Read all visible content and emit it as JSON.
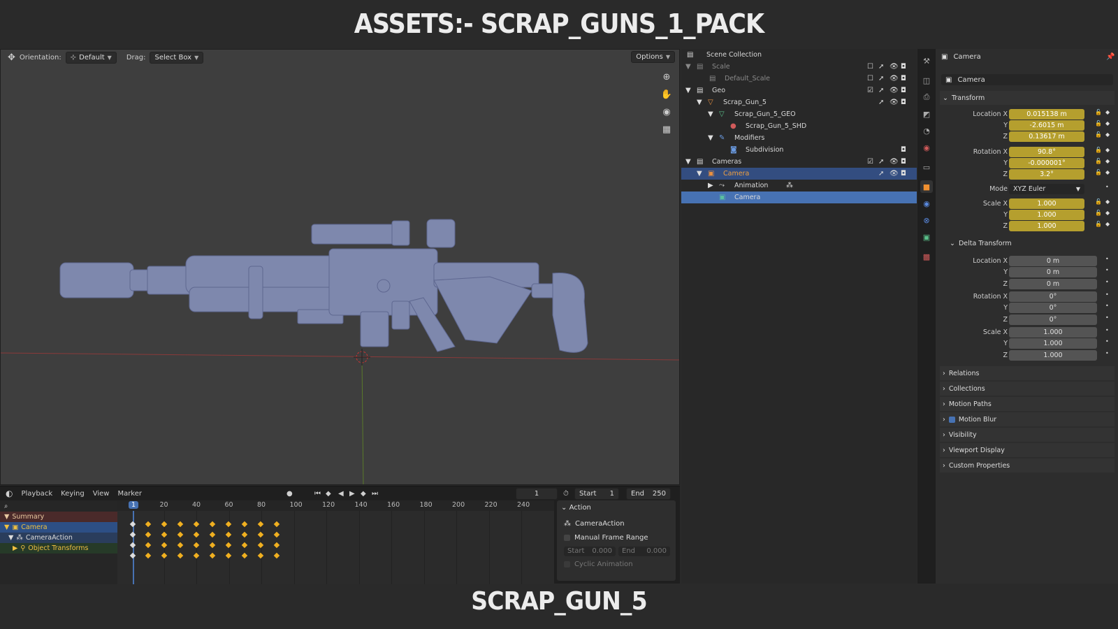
{
  "banner": {
    "top": "ASSETS:- SCRAP_GUNS_1_PACK",
    "bottom": "SCRAP_GUN_5"
  },
  "viewport": {
    "orientation_label": "Orientation:",
    "orientation_value": "Default",
    "drag_label": "Drag:",
    "drag_value": "Select Box",
    "options_label": "Options"
  },
  "timeline": {
    "menus": [
      "Playback",
      "Keying",
      "View",
      "Marker"
    ],
    "current_frame": "1",
    "start_label": "Start",
    "start_value": "1",
    "end_label": "End",
    "end_value": "250",
    "ruler": [
      "1",
      "20",
      "40",
      "60",
      "80",
      "100",
      "120",
      "140",
      "160",
      "180",
      "200",
      "220",
      "240"
    ],
    "channels": [
      "Summary",
      "Camera",
      "CameraAction",
      "Object Transforms"
    ],
    "action_panel": {
      "title": "Action",
      "action_name": "CameraAction",
      "manual_range": "Manual Frame Range",
      "start_label": "Start",
      "start_value": "0.000",
      "end_label": "End",
      "end_value": "0.000",
      "cyclic": "Cyclic Animation"
    }
  },
  "outliner": {
    "rows": [
      {
        "label": "Scene Collection"
      },
      {
        "label": "Scale"
      },
      {
        "label": "Default_Scale"
      },
      {
        "label": "Geo"
      },
      {
        "label": "Scrap_Gun_5"
      },
      {
        "label": "Scrap_Gun_5_GEO"
      },
      {
        "label": "Scrap_Gun_5_SHD"
      },
      {
        "label": "Modifiers"
      },
      {
        "label": "Subdivision"
      },
      {
        "label": "Cameras"
      },
      {
        "label": "Camera"
      },
      {
        "label": "Animation"
      },
      {
        "label": "Camera"
      }
    ]
  },
  "properties": {
    "header": "Camera",
    "datablock": "Camera",
    "transform_title": "Transform",
    "location": {
      "label": "Location X",
      "x": "0.015138 m",
      "y": "-2.6015 m",
      "z": "0.13617 m"
    },
    "rotation": {
      "label": "Rotation X",
      "x": "90.8°",
      "y": "-0.000001°",
      "z": "3.2°"
    },
    "mode_label": "Mode",
    "mode_value": "XYZ Euler",
    "scale": {
      "label": "Scale X",
      "x": "1.000",
      "y": "1.000",
      "z": "1.000"
    },
    "delta_title": "Delta Transform",
    "delta_location": {
      "label": "Location X",
      "x": "0 m",
      "y": "0 m",
      "z": "0 m"
    },
    "delta_rotation": {
      "label": "Rotation X",
      "x": "0°",
      "y": "0°",
      "z": "0°"
    },
    "delta_scale": {
      "label": "Scale X",
      "x": "1.000",
      "y": "1.000",
      "z": "1.000"
    },
    "axis_y": "Y",
    "axis_z": "Z",
    "sections": [
      "Relations",
      "Collections",
      "Motion Paths",
      "Motion Blur",
      "Visibility",
      "Viewport Display",
      "Custom Properties"
    ]
  },
  "colors": {
    "animated_field": "#b59f2e",
    "selection": "#4772b3",
    "keyframe": "#f0b020"
  }
}
